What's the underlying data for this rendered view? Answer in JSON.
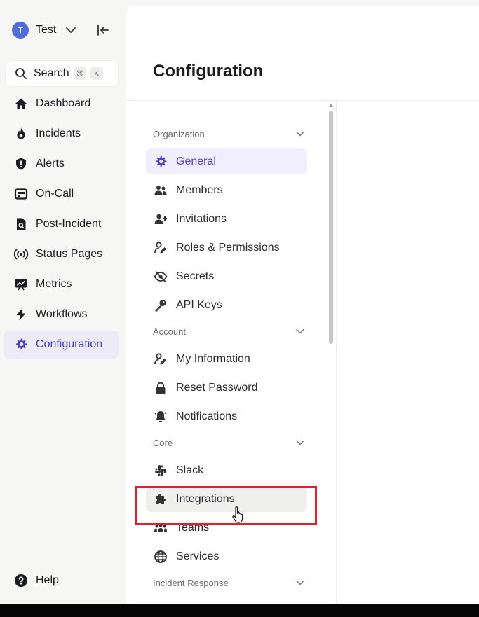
{
  "workspace": {
    "initial": "T",
    "name": "Test"
  },
  "search": {
    "label": "Search",
    "shortcut": [
      "⌘",
      "K"
    ]
  },
  "nav": [
    {
      "label": "Dashboard",
      "icon": "home-icon"
    },
    {
      "label": "Incidents",
      "icon": "flame-icon"
    },
    {
      "label": "Alerts",
      "icon": "shield-alert-icon"
    },
    {
      "label": "On-Call",
      "icon": "pager-icon"
    },
    {
      "label": "Post-Incident",
      "icon": "document-search-icon"
    },
    {
      "label": "Status Pages",
      "icon": "broadcast-icon"
    },
    {
      "label": "Metrics",
      "icon": "chart-board-icon"
    },
    {
      "label": "Workflows",
      "icon": "lightning-icon"
    },
    {
      "label": "Configuration",
      "icon": "gear-icon",
      "active": true
    }
  ],
  "help": {
    "label": "Help"
  },
  "page": {
    "title": "Configuration"
  },
  "sections": [
    {
      "title": "Organization",
      "items": [
        {
          "label": "General",
          "icon": "gear-icon",
          "active": true
        },
        {
          "label": "Members",
          "icon": "users-icon"
        },
        {
          "label": "Invitations",
          "icon": "user-plus-icon"
        },
        {
          "label": "Roles & Permissions",
          "icon": "user-pen-icon"
        },
        {
          "label": "Secrets",
          "icon": "eye-slash-icon"
        },
        {
          "label": "API Keys",
          "icon": "key-icon"
        }
      ]
    },
    {
      "title": "Account",
      "items": [
        {
          "label": "My Information",
          "icon": "user-pen-icon"
        },
        {
          "label": "Reset Password",
          "icon": "lock-icon"
        },
        {
          "label": "Notifications",
          "icon": "bell-icon"
        }
      ]
    },
    {
      "title": "Core",
      "items": [
        {
          "label": "Slack",
          "icon": "slack-icon"
        },
        {
          "label": "Integrations",
          "icon": "puzzle-icon",
          "hovered": true
        },
        {
          "label": "Teams",
          "icon": "people-group-icon"
        },
        {
          "label": "Services",
          "icon": "globe-icon"
        }
      ]
    },
    {
      "title": "Incident Response",
      "items": []
    }
  ],
  "colors": {
    "accent": "#5b3ec7",
    "active_bg": "#f1eefd",
    "highlight_box": "#e0202c"
  }
}
